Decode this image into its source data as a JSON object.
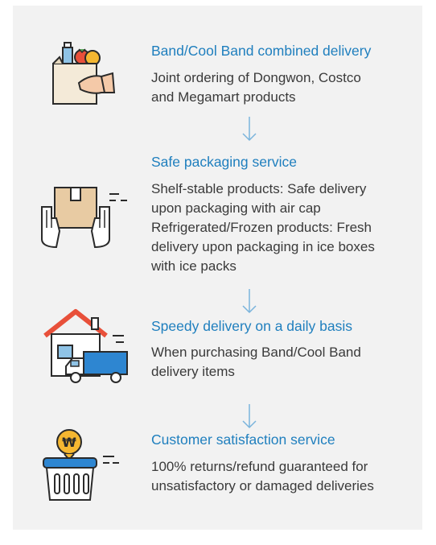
{
  "items": [
    {
      "icon": "grocery-bag-icon",
      "title": "Band/Cool Band combined delivery",
      "desc": [
        "Joint ordering of Dongwon, Costco",
        "and Megamart products"
      ]
    },
    {
      "icon": "package-hands-icon",
      "title": "Safe packaging service",
      "desc": [
        "Shelf-stable products: Safe delivery",
        "upon packaging with air cap",
        "Refrigerated/Frozen products: Fresh",
        "delivery upon packaging in ice boxes",
        "with ice packs"
      ]
    },
    {
      "icon": "house-truck-icon",
      "title": "Speedy delivery on a daily basis",
      "desc": [
        "When purchasing Band/Cool Band",
        "delivery items"
      ]
    },
    {
      "icon": "basket-coin-icon",
      "coin_symbol": "₩",
      "title": "Customer satisfaction service",
      "desc": [
        "100% returns/refund guaranteed for",
        "unsatisfactory or damaged deliveries"
      ]
    }
  ],
  "colors": {
    "title": "#1f7fbe",
    "text": "#3a3a3a",
    "panel": "#f2f2f2",
    "arrow": "#7ab4dc",
    "outline": "#2a2a2a"
  }
}
